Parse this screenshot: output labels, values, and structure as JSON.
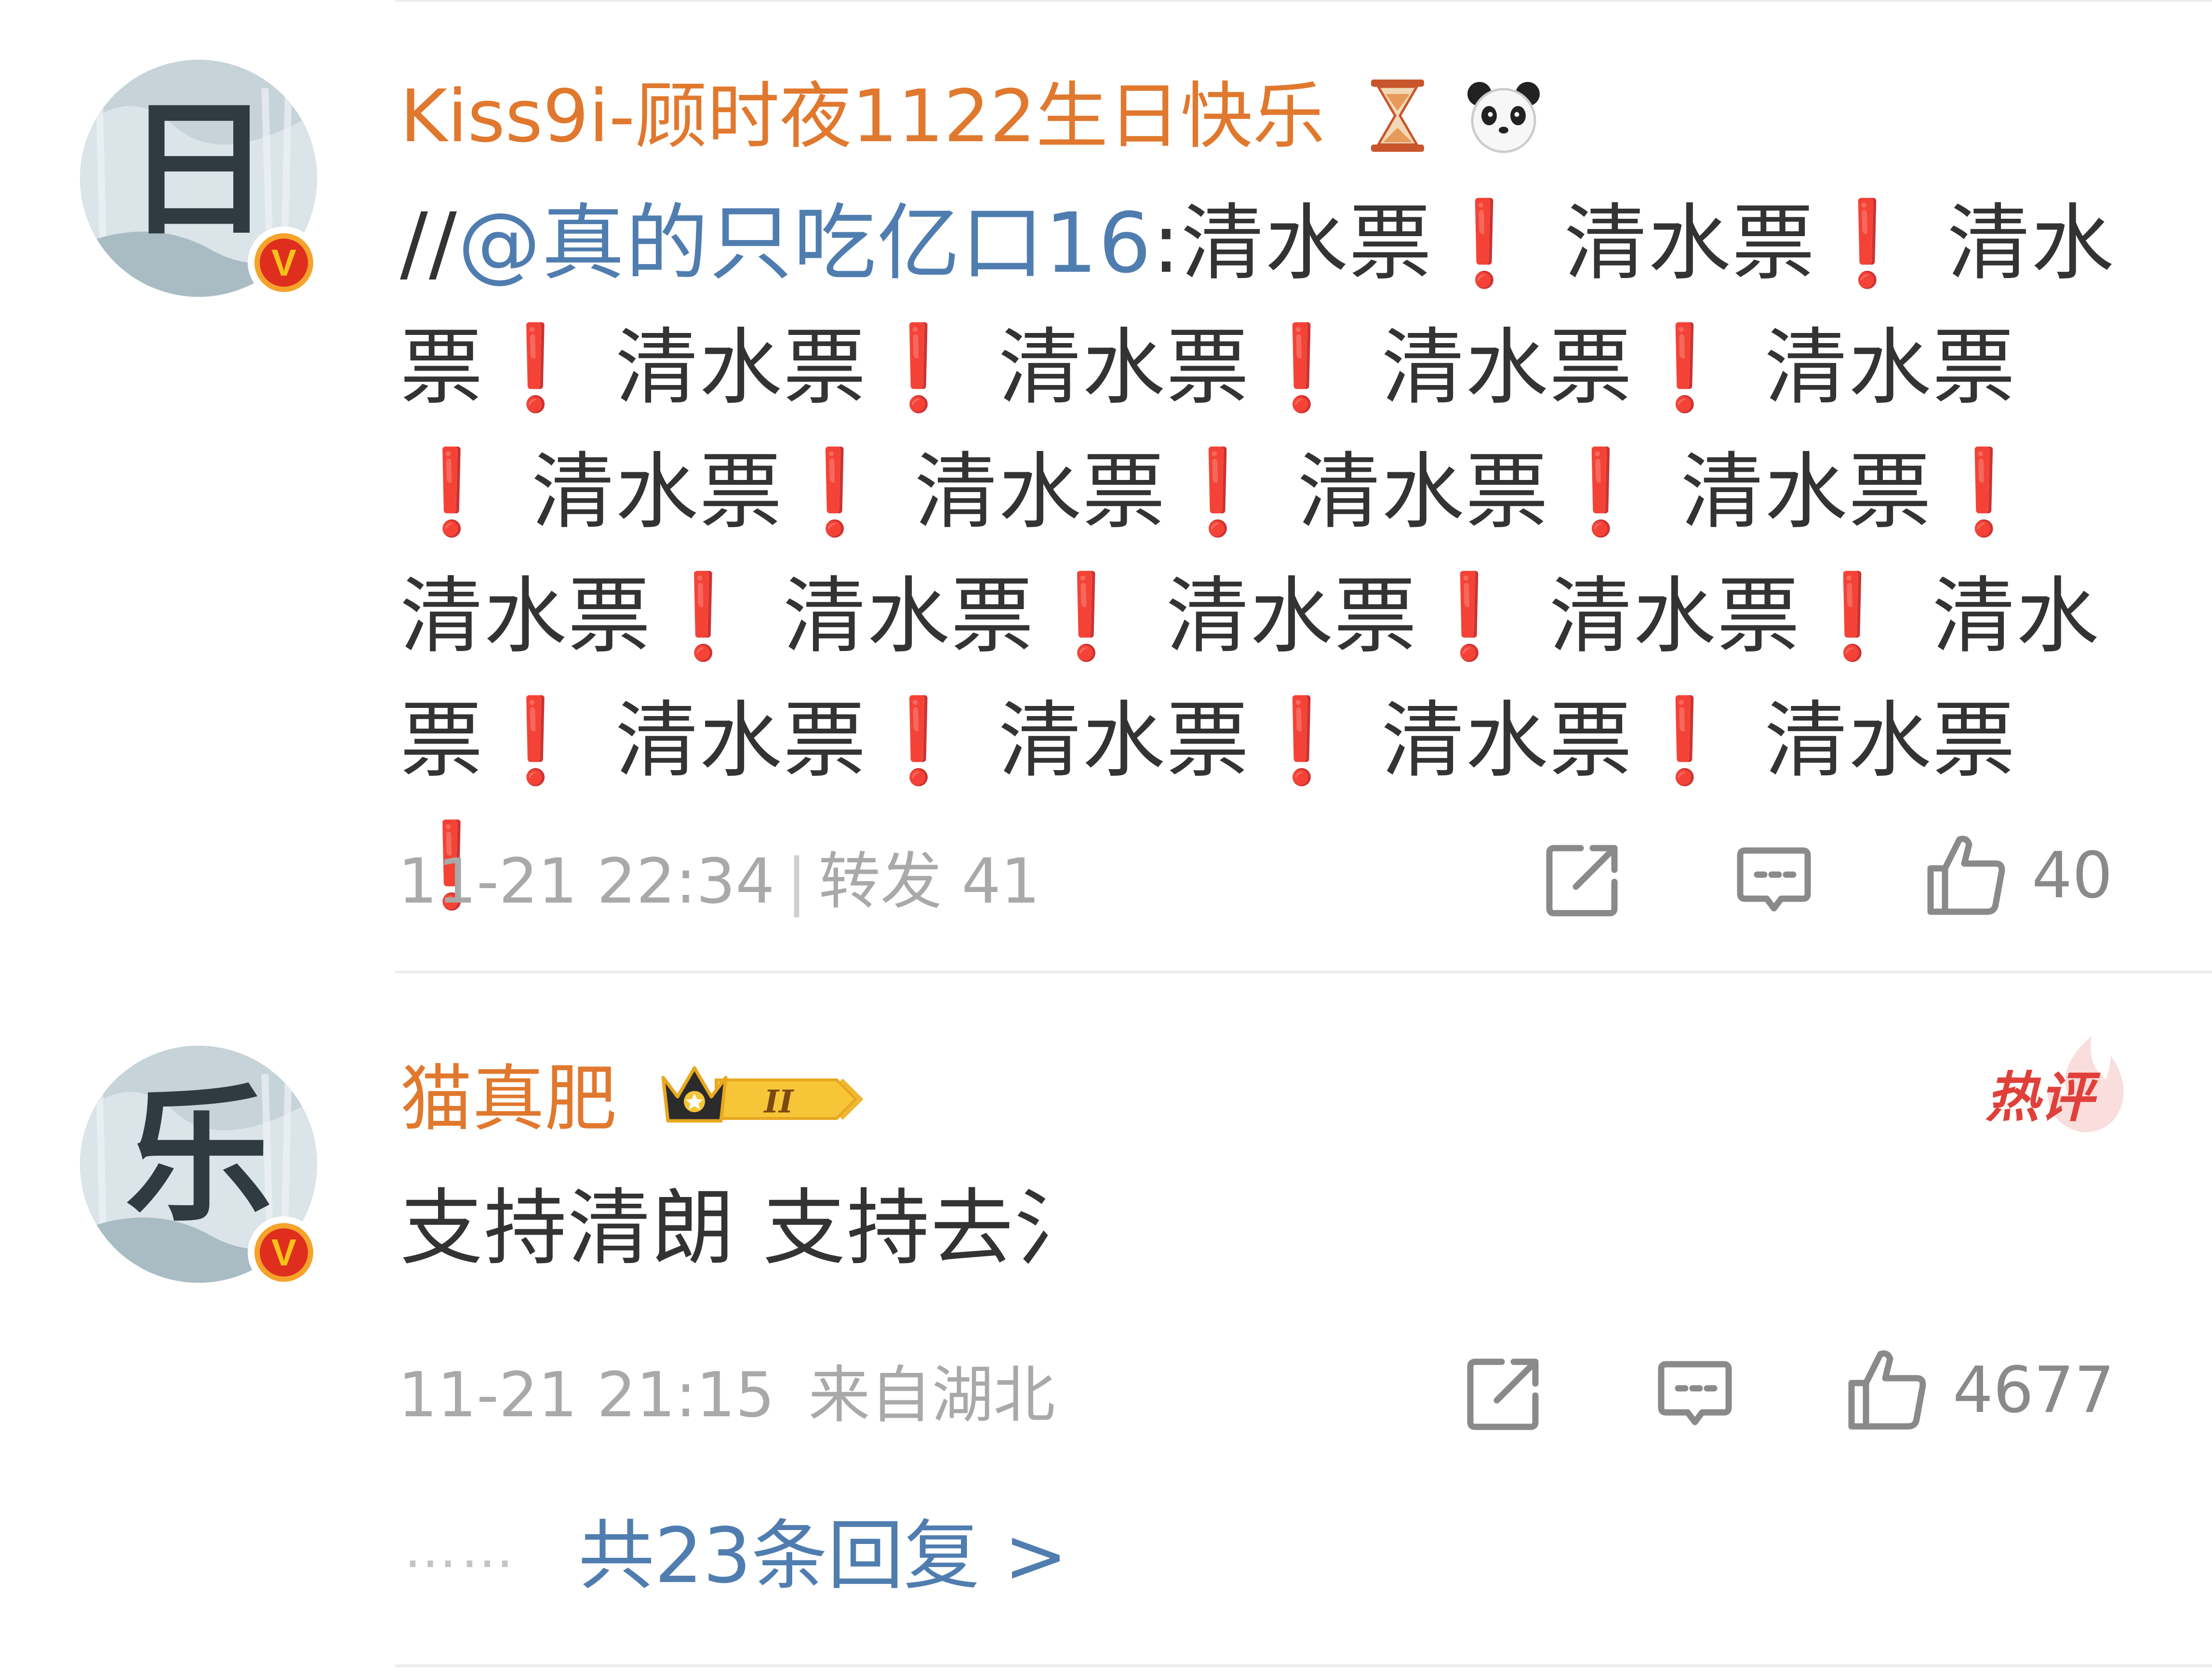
{
  "colors": {
    "username": "#e0782e",
    "mention": "#507daf",
    "exclaim": "#e02020",
    "meta": "#a9a9a9",
    "hot": "#e0403a"
  },
  "comments": [
    {
      "avatar_glyph": "日",
      "username": "Kiss9i-顾时夜1122生日快乐",
      "username_emojis": [
        "hourglass-emoji",
        "panda-emoji"
      ],
      "prefix": "//",
      "mention": "@真的只吃亿口16",
      "colon": ":",
      "repeat_word": "清水票",
      "repeat_count": 20,
      "exclaim": "❗",
      "timestamp": "11-21 22:34",
      "divider": "|",
      "repost_label": "转发 41",
      "like_count": "40"
    },
    {
      "avatar_glyph": "乐",
      "username": "猫真肥",
      "level_badge": "II",
      "hot_label": "热评",
      "text": "支持清朗 支持去氵",
      "timestamp": "11-21 21:15",
      "location": "来自湖北",
      "like_count": "4677",
      "dots": "……",
      "replies_label": "共23条回复 >"
    }
  ]
}
